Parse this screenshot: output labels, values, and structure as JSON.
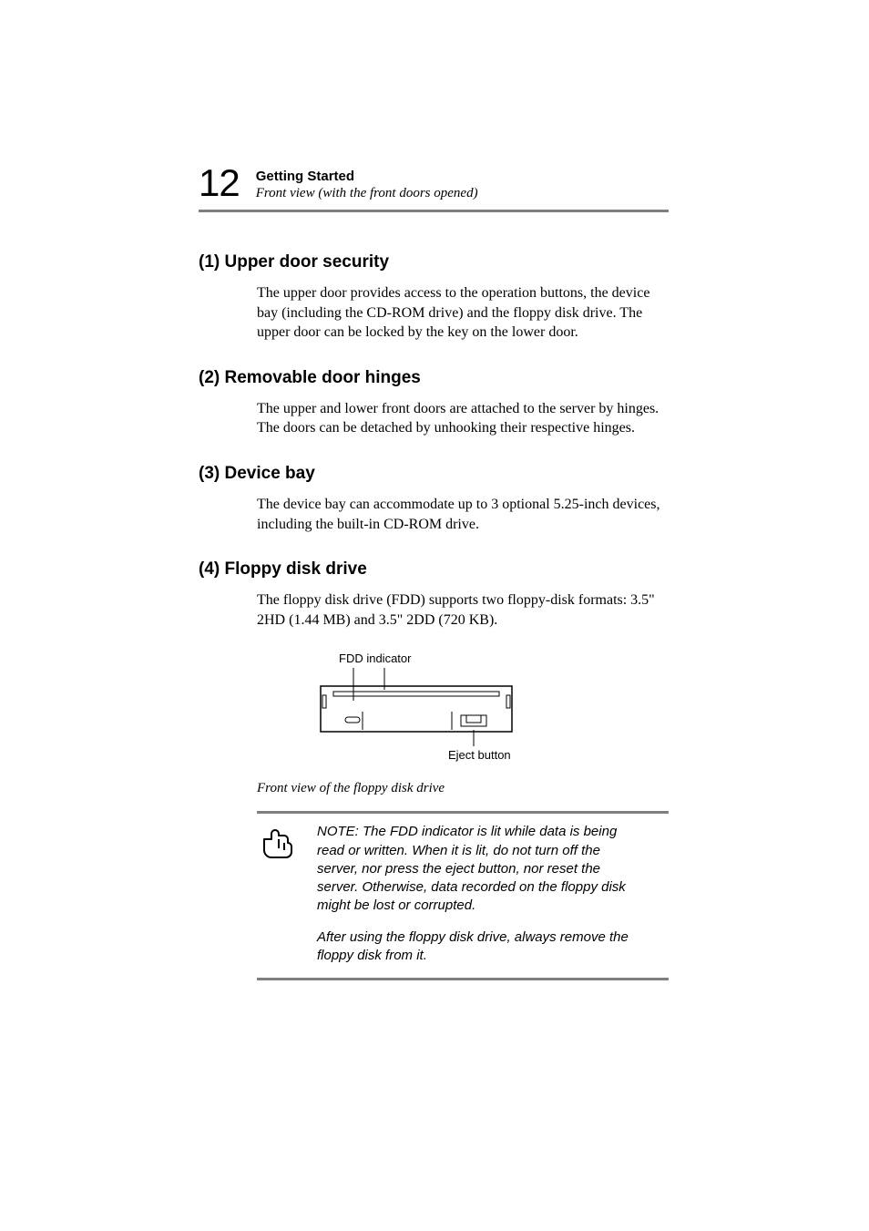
{
  "header": {
    "page_number": "12",
    "chapter": "Getting Started",
    "breadcrumb": "Front view (with the front doors opened)"
  },
  "sections": {
    "s1": {
      "heading": "(1) Upper door security",
      "body": "The upper door provides access to the operation buttons, the device bay (including the CD-ROM drive) and the floppy disk drive. The upper door can be locked by the key on the lower door."
    },
    "s2": {
      "heading": "(2) Removable door hinges",
      "body_a": "The upper and lower front doors are attached to the server by hinges.",
      "body_b": "The doors can be detached by unhooking their respective hinges."
    },
    "s3": {
      "heading": "(3) Device bay",
      "body": "The device bay can accommodate up to 3 optional 5.25-inch devices, including the built-in CD-ROM drive."
    },
    "s4": {
      "heading": "(4) Floppy disk drive",
      "body": "The floppy disk drive (FDD) supports two floppy-disk formats: 3.5\" 2HD (1.44 MB) and 3.5\" 2DD (720 KB)."
    }
  },
  "figure": {
    "label_indicator": "FDD indicator",
    "label_eject": "Eject button",
    "caption": "Front view of the floppy disk drive"
  },
  "note": {
    "p1": "NOTE: The FDD indicator is lit while data is being read or written.  When it is lit, do not turn off the server, nor press the eject button, nor reset the server.  Otherwise, data recorded on the floppy disk might be lost or corrupted.",
    "p2": "After using the floppy disk drive, always remove the floppy disk from it."
  }
}
